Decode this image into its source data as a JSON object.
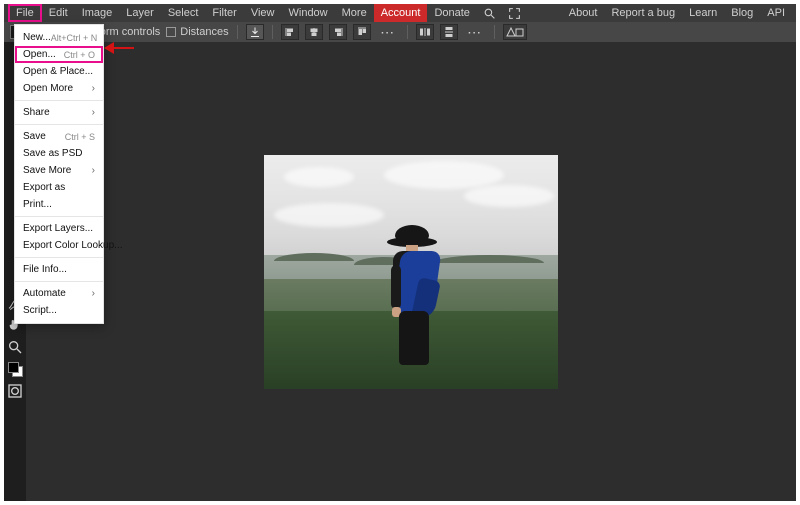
{
  "menubar": {
    "items": [
      "File",
      "Edit",
      "Image",
      "Layer",
      "Select",
      "Filter",
      "View",
      "Window",
      "More",
      "Account",
      "Donate"
    ],
    "right": [
      "About",
      "Report a bug",
      "Learn",
      "Blog",
      "API"
    ]
  },
  "optbar": {
    "transform": "Transform controls",
    "distances": "Distances"
  },
  "dropdown": {
    "items": [
      {
        "label": "New...",
        "shortcut": "Alt+Ctrl + N"
      },
      {
        "label": "Open...",
        "shortcut": "Ctrl + O",
        "highlight": true
      },
      {
        "label": "Open & Place..."
      },
      {
        "label": "Open More",
        "submenu": true
      },
      {
        "label": "Share",
        "submenu": true,
        "sep_before": true
      },
      {
        "label": "Save",
        "shortcut": "Ctrl + S",
        "sep_before": true
      },
      {
        "label": "Save as PSD"
      },
      {
        "label": "Save More",
        "submenu": true
      },
      {
        "label": "Export as"
      },
      {
        "label": "Print..."
      },
      {
        "label": "Export Layers...",
        "sep_before": true
      },
      {
        "label": "Export Color Lookup..."
      },
      {
        "label": "File Info...",
        "sep_before": true
      },
      {
        "label": "Automate",
        "submenu": true,
        "sep_before": true
      },
      {
        "label": "Script..."
      }
    ]
  }
}
